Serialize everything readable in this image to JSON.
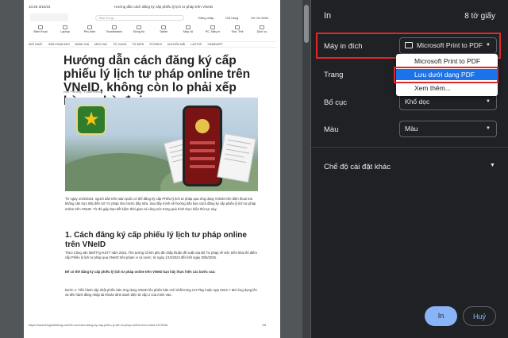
{
  "preview_page": {
    "header_date": "10:28 3/10/24",
    "header_title": "Hướng dẫn cách đăng ký cấp phiếu lý lịch tư pháp trên VNeID",
    "search_placeholder": "Bạn tìm gì...",
    "site_links": [
      "Đăng nhập",
      "Giỏ hàng",
      "Hồ Chí Minh"
    ],
    "categories": [
      "Điện thoại",
      "Laptop",
      "Phụ kiện",
      "Smartwatch",
      "Đồng hồ",
      "Tablet",
      "Máy cũ",
      "PC, Máy in",
      "Sim, Thẻ",
      "Dịch vụ"
    ],
    "menu": [
      "MỚI NHẤT",
      "SẢN PHẨM MỚI",
      "ĐÁNH GIÁ",
      "MẸO HAY",
      "TỪ VỰNG",
      "TỪ ĐIỂN",
      "STORIES",
      "KHUYẾN MÃI",
      "LAPTOP",
      "GAME/APP"
    ],
    "title": "Hướng dẫn cách đăng ký cấp phiếu lý lịch tư pháp online trên VNeID, không còn lo phải xếp hàng chờ đợi",
    "byline": "Như Phương · 1 tuần trước",
    "paragraph1": "Từ ngày 1/10/2024, người dân trên toàn quốc có thể đăng ký cấp Phiếu lý lịch tư pháp qua ứng dụng VNeID trên điện thoại mà không cần trực tiếp đến Sở Tư pháp như trước đây nữa. Sau đây mình sẽ hướng dẫn bạn cách đăng ký cấp phiếu lý lịch tư pháp online trên VNeID. Từ đó giúp bạn tiết kiệm thời gian và công sức trong quá trình thực hiện thủ tục này.",
    "heading2": "1. Cách đăng ký cấp phiếu lý lịch tư pháp online trên VNeID",
    "paragraph2": "Theo Công văn 550/TTg-KSTT năm 2024, Thủ tướng Chính phủ đã chấp thuận đề xuất của Bộ Tư pháp về việc triển khai thí điểm cấp Phiếu lý lịch tư pháp qua VNeID trên phạm vi cả nước, từ ngày 1/10/2024 đến hết ngày 30/6/2025.",
    "paragraph3": "Để có thể đăng ký cấp phiếu lý lịch tư pháp online trên VNeID bạn hãy thực hiện các bước sau:",
    "paragraph4": "Bước 1: Tiến hành cập nhật phiên bản ứng dụng VNeID lên phiên bản mới nhất trong CH Play hoặc App Store > Mở ứng dụng lên và tiến hành đăng nhập tài khoản định danh điện tử cấp 2 của mình vào.",
    "footer_url": "https://www.thegioididong.com/tin-tuc/cach-dang-ky-cap-phieu-ly-lich-tu-phap-online-tren-vneid-1570618",
    "footer_page": "1/8"
  },
  "dialog": {
    "title": "In",
    "sheet_count": "8 tờ giấy",
    "destination_label": "Máy in đích",
    "destination_value": "Microsoft Print to PDF",
    "pages_label": "Trang",
    "layout_label": "Bố cục",
    "layout_value": "Khổ dọc",
    "color_label": "Màu",
    "color_value": "Màu",
    "more_settings_label": "Chế độ cài đặt khác",
    "destination_options": [
      "Microsoft Print to PDF",
      "Lưu dưới dạng PDF",
      "Xem thêm..."
    ],
    "selected_option_index": 1,
    "print_button": "In",
    "cancel_button": "Huỷ"
  },
  "colors": {
    "panel_bg": "#202124",
    "accent": "#8ab4f8",
    "selected_option": "#1a73e8",
    "annotation_red": "#e3262b"
  }
}
